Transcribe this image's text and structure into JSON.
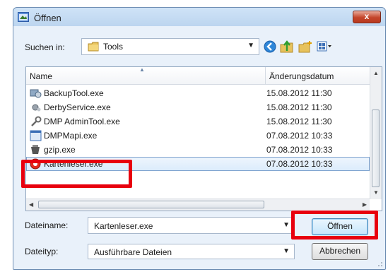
{
  "window": {
    "title": "Öffnen",
    "close_label": "x"
  },
  "location": {
    "label": "Suchen in:",
    "value": "Tools"
  },
  "list": {
    "columns": {
      "name": "Name",
      "date": "Änderungsdatum"
    },
    "files": [
      {
        "name": "BackupTool.exe",
        "date": "15.08.2012 11:30",
        "icon": "backup-tool-icon"
      },
      {
        "name": "DerbyService.exe",
        "date": "15.08.2012 11:30",
        "icon": "service-icon"
      },
      {
        "name": "DMP AdminTool.exe",
        "date": "15.08.2012 11:30",
        "icon": "admin-tool-icon"
      },
      {
        "name": "DMPMapi.exe",
        "date": "07.08.2012 10:33",
        "icon": "application-icon"
      },
      {
        "name": "gzip.exe",
        "date": "07.08.2012 10:33",
        "icon": "gzip-icon"
      },
      {
        "name": "Kartenleser.exe",
        "date": "07.08.2012 10:33",
        "icon": "card-reader-icon",
        "selected": true
      }
    ]
  },
  "filename": {
    "label": "Dateiname:",
    "value": "Kartenleser.exe"
  },
  "filetype": {
    "label": "Dateityp:",
    "value": "Ausführbare Dateien"
  },
  "buttons": {
    "open": "Öffnen",
    "cancel": "Abbrechen"
  },
  "colors": {
    "highlight": "#e8000e",
    "selection": "#dcecfc"
  }
}
